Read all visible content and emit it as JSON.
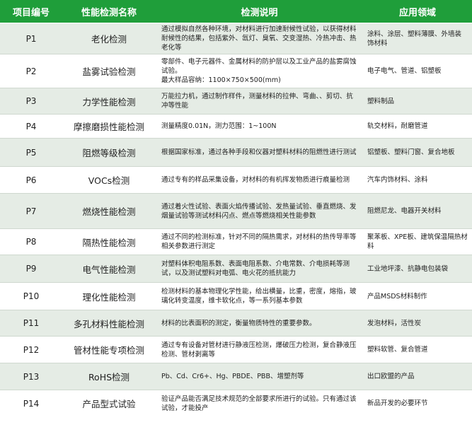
{
  "headers": {
    "code": "项目编号",
    "name": "性能检测名称",
    "desc": "检测说明",
    "app": "应用领域"
  },
  "rows": [
    {
      "code": "P1",
      "name": "老化检测",
      "desc": "通过模拟自然各种环境，对材料进行加速耐候性试验，以获得材料耐候性的结果，包括紫外、氙灯、臭氧、交变湿热、冷热冲击、热老化等",
      "app": "涂料、涂层、塑料薄膜、外墙装饰材料"
    },
    {
      "code": "P2",
      "name": "盐雾试验检测",
      "desc": "零部件、电子元器件、金属材料的防护层以及工业产品的盐雾腐蚀试验。",
      "desc2": "最大样品容纳：1100×750×500(mm)",
      "app": "电子电气、管道、铝塑板"
    },
    {
      "code": "P3",
      "name": "力学性能检测",
      "desc": "万能拉力机，通过制作样件，测量材料的拉伸、弯曲、、剪切、抗冲等性能",
      "app": "塑料制品"
    },
    {
      "code": "P4",
      "name": "摩擦磨损性能检测",
      "desc": "测量精度0.01N，测力范围：1~100N",
      "app": "轨交材料，耐磨管道"
    },
    {
      "code": "P5",
      "name": "阻燃等级检测",
      "desc": "根据国家标准，通过各种手段和仪器对塑料材料的阻燃性进行测试",
      "app": "铝塑板、塑料门窗、复合地板"
    },
    {
      "code": "P6",
      "name": "VOCs检测",
      "desc": "通过专有的样品采集设备，对材料的有机挥发物质进行痕量检测",
      "app": "汽车内饰材料、涂料"
    },
    {
      "code": "P7",
      "name": "燃烧性能检测",
      "desc": "通过着火性试验、表面火焰传播试验、发热量试验、垂直燃烧、发烟量试验等测试材料闪点、燃点等燃烧相关性能参数",
      "app": "阻燃尼龙、电器开关材料"
    },
    {
      "code": "P8",
      "name": "隔热性能检测",
      "desc": "通过不同的检测标准，针对不同的隔热需求，对材料的热传导率等相关参数进行测定",
      "app": "聚苯板、XPE板、建筑保温隔热材料"
    },
    {
      "code": "P9",
      "name": "电气性能检测",
      "desc": "对塑料体积电阻系数、表面电阻系数、介电常数、介电损耗等测试，以及测试塑料对电弧、电火花的抵抗能力",
      "app": "工业地坪漆、抗静电包装袋"
    },
    {
      "code": "P10",
      "name": "理化性能检测",
      "desc": "检测材料的基本物理化学性能，给出横量，比重，密度，熔指，玻璃化转变温度，维卡软化点，等一系列基本参数",
      "app": "产品MSDS材料制作"
    },
    {
      "code": "P11",
      "name": "多孔材料性能检测",
      "desc": "材料的比表面积的测定，衡量物质特性的重要参数。",
      "app": "发泡材料，活性炭"
    },
    {
      "code": "P12",
      "name": "管材性能专项检测",
      "desc": "通过专有设备对管材进行静液压检测，爆破压力检测，复合静液压检测、管材剥离等",
      "app": "塑料软管、复合管道"
    },
    {
      "code": "P13",
      "name": "RoHS检测",
      "desc": "Pb、Cd、Cr6+、Hg、PBDE、PBB、增塑剂等",
      "app": "出口欧盟的产品"
    },
    {
      "code": "P14",
      "name": "产品型式试验",
      "desc": "验证产品能否满足技术规范的全部要求所进行的试验。只有通过该试验，才能投产",
      "app": "新品开发的必要环节"
    }
  ]
}
